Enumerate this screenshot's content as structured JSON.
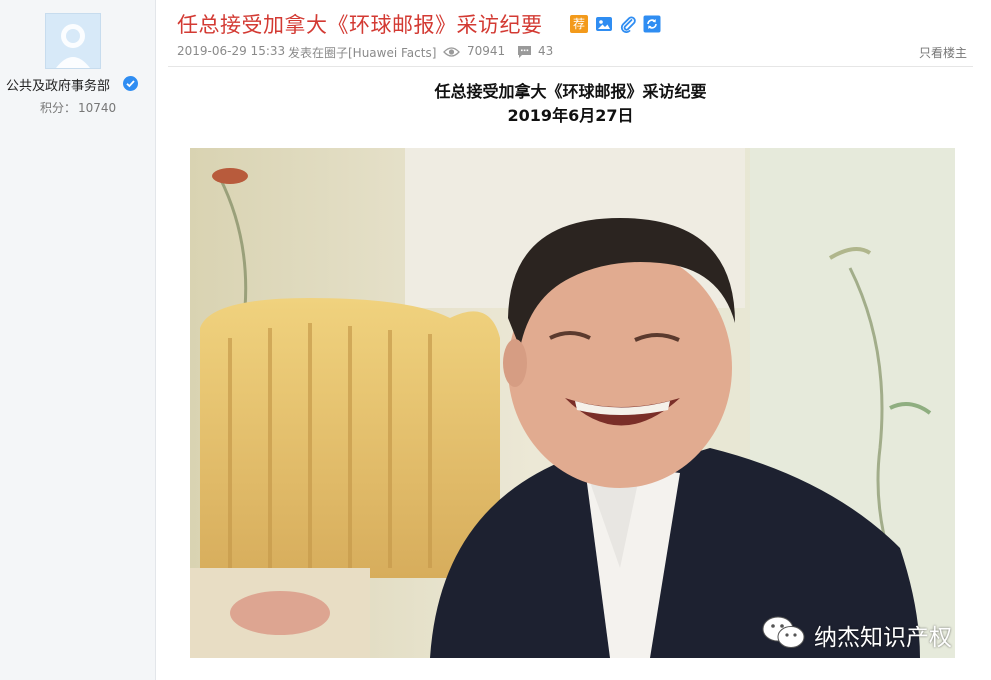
{
  "author": {
    "name": "公共及政府事务部",
    "points_label": "积分：",
    "points_value": "10740"
  },
  "post": {
    "title": "任总接受加拿大《环球邮报》采访纪要",
    "date": "2019-06-29 15:33",
    "posted_in": "发表在圈子[Huawei Facts]",
    "views": "70941",
    "comments": "43",
    "only_op_label": "只看楼主",
    "heading_line1": "任总接受加拿大《环球邮报》采访纪要",
    "heading_line2": "2019年6月27日"
  },
  "title_icons": [
    "recommend-icon",
    "image-icon",
    "attachment-icon",
    "refresh-icon"
  ],
  "recommend_badge": "荐",
  "watermark": {
    "text": "纳杰知识产权"
  },
  "colors": {
    "title_red": "#d33a33",
    "badge_orange": "#f39a1b",
    "icon_blue": "#2f8df2",
    "sidebar_bg": "#f4f6f8"
  }
}
